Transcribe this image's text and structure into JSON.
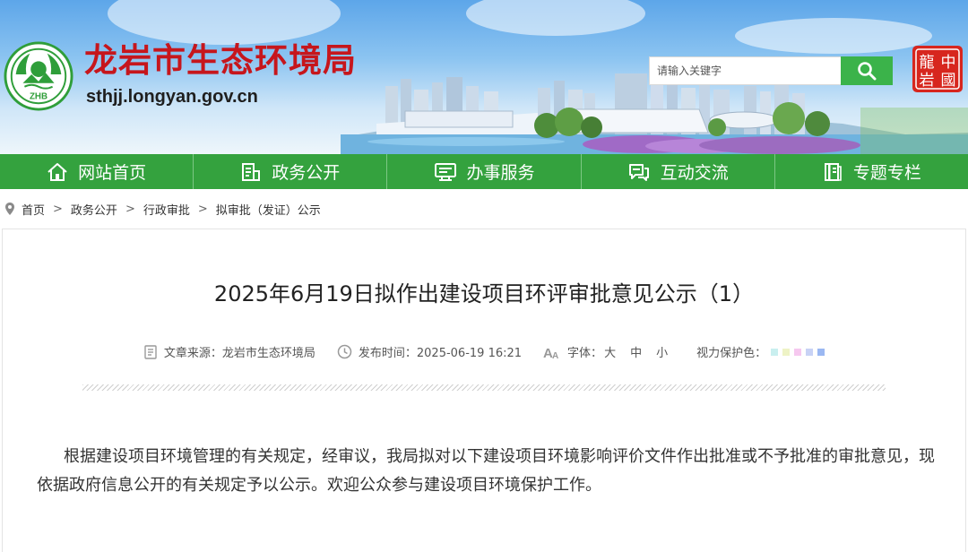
{
  "header": {
    "site_name": "龙岩市生态环境局",
    "site_url": "sthjj.longyan.gov.cn",
    "logo_text": "ZHB",
    "seal_text": "龍岩中國",
    "search": {
      "placeholder": "请输入关键字"
    }
  },
  "nav": {
    "items": [
      {
        "label": "网站首页",
        "icon": "home-icon"
      },
      {
        "label": "政务公开",
        "icon": "document-list-icon"
      },
      {
        "label": "办事服务",
        "icon": "service-window-icon"
      },
      {
        "label": "互动交流",
        "icon": "chat-icon"
      },
      {
        "label": "专题专栏",
        "icon": "book-icon"
      }
    ]
  },
  "breadcrumb": {
    "items": [
      "首页",
      "政务公开",
      "行政审批",
      "拟审批（发证）公示"
    ],
    "separator": ">"
  },
  "article": {
    "title": "2025年6月19日拟作出建设项目环评审批意见公示（1）",
    "meta": {
      "source": "文章来源：龙岩市生态环境局",
      "publish_time": "发布时间：2025-06-19 16:21",
      "font_size_label": "字体：",
      "font_sizes": [
        "大",
        "中",
        "小"
      ],
      "eye_care_label": "视力保护色：",
      "eye_care_colors": [
        "#c9efef",
        "#eef3c6",
        "#f6c8ef",
        "#c8d2f5",
        "#9bb8f2"
      ]
    },
    "body": "根据建设项目环境管理的有关规定，经审议，我局拟对以下建设项目环境影响评价文件作出批准或不予批准的审批意见，现依据政府信息公开的有关规定予以公示。欢迎公众参与建设项目环境保护工作。"
  },
  "colors": {
    "brand_green": "#34a23e",
    "search_green": "#3bb34a",
    "title_red": "#c6161c"
  }
}
